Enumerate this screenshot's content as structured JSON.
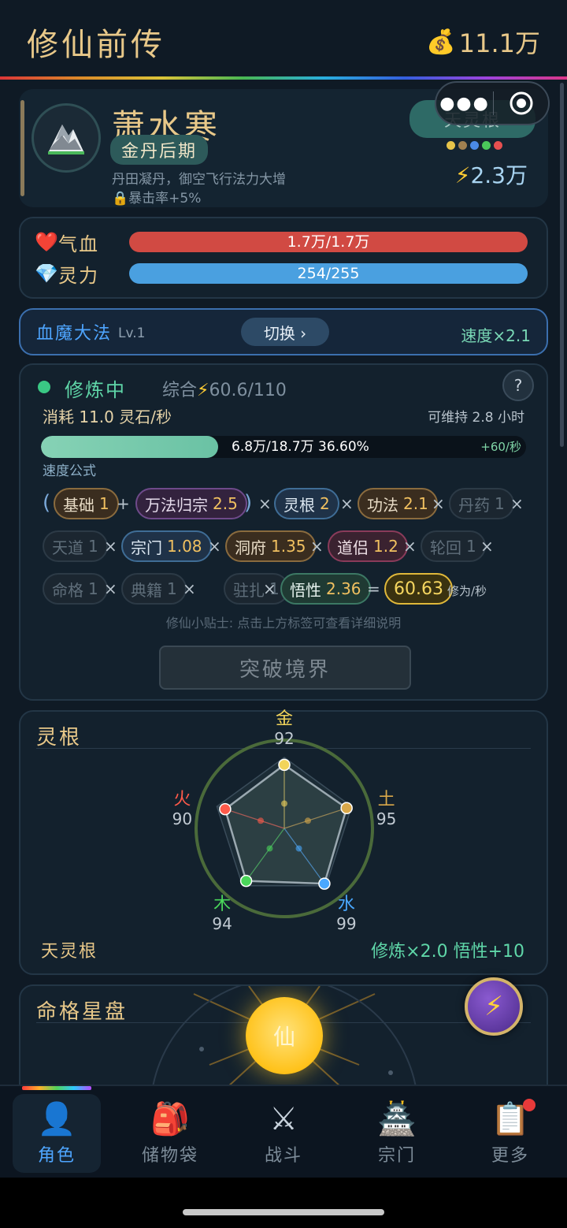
{
  "header": {
    "title": "修仙前传",
    "coin_icon": "money-bag-icon",
    "coins": "11.1万"
  },
  "mini_program": {
    "more_icon": "more-dots-icon",
    "close_icon": "target-close-icon"
  },
  "profile": {
    "name": "萧水寒",
    "realm": "金丹后期",
    "realm_desc": "丹田凝丹，御空飞行法力大增",
    "crit": "暴击率+5%",
    "spirit_root": "天灵根",
    "root_dots": [
      "#e6c44a",
      "#a08050",
      "#4a8ae6",
      "#4ac85a",
      "#e65050"
    ],
    "power": "2.3万"
  },
  "stats": {
    "hp_label": "气血",
    "hp_value": "1.7万/1.7万",
    "hp_fraction": 1.0,
    "mp_label": "灵力",
    "mp_value": "254/255",
    "mp_fraction": 0.996
  },
  "technique": {
    "name": "血魔大法",
    "level": "Lv.1",
    "switch_label": "切换 ›",
    "speed": "速度×2.1"
  },
  "cultivation": {
    "status": "修炼中",
    "overall_prefix": "综合",
    "overall_value": "60.6/110",
    "help": "?",
    "consume": "消耗 11.0 灵石/秒",
    "sustain": "可维持 2.8 小时",
    "xp_text": "6.8万/18.7万  36.60%",
    "xp_fraction": 0.366,
    "xp_rate": "+60/秒",
    "formula_label": "速度公式",
    "paren_open": "(",
    "paren_close": ")",
    "plus": "+",
    "times": "×",
    "equals": "=",
    "factors": [
      {
        "label": "基础",
        "value": "1"
      },
      {
        "label": "万法归宗",
        "value": "2.5"
      },
      {
        "label": "灵根",
        "value": "2"
      },
      {
        "label": "功法",
        "value": "2.1"
      },
      {
        "label": "丹药",
        "value": "1"
      },
      {
        "label": "天道",
        "value": "1"
      },
      {
        "label": "宗门",
        "value": "1.08"
      },
      {
        "label": "洞府",
        "value": "1.35"
      },
      {
        "label": "道侣",
        "value": "1.2"
      },
      {
        "label": "轮回",
        "value": "1"
      },
      {
        "label": "命格",
        "value": "1"
      },
      {
        "label": "典籍",
        "value": "1"
      },
      {
        "label": "驻扎",
        "value": "1"
      },
      {
        "label": "悟性",
        "value": "2.36"
      }
    ],
    "result": "60.63",
    "result_unit": "修为/秒",
    "tip": "修仙小贴士: 点击上方标签可查看详细说明",
    "breakthrough": "突破境界"
  },
  "spirit_root": {
    "title": "灵根",
    "elements": [
      {
        "name": "金",
        "value": "92",
        "color": "#f2d45a"
      },
      {
        "name": "土",
        "value": "95",
        "color": "#d9a84a"
      },
      {
        "name": "水",
        "value": "99",
        "color": "#4aa8ff"
      },
      {
        "name": "木",
        "value": "94",
        "color": "#4ad65a"
      },
      {
        "name": "火",
        "value": "90",
        "color": "#ff5a4a"
      }
    ],
    "root_name": "天灵根",
    "bonus": "修炼×2.0  悟性+10"
  },
  "star_chart": {
    "title": "命格星盘",
    "center": "仙"
  },
  "fab": {
    "icon": "lightning-icon",
    "glyph": "⚡"
  },
  "nav": [
    {
      "label": "角色",
      "icon": "👤"
    },
    {
      "label": "储物袋",
      "icon": "🎒"
    },
    {
      "label": "战斗",
      "icon": "⚔"
    },
    {
      "label": "宗门",
      "icon": "🏯"
    },
    {
      "label": "更多",
      "icon": "📋"
    }
  ]
}
